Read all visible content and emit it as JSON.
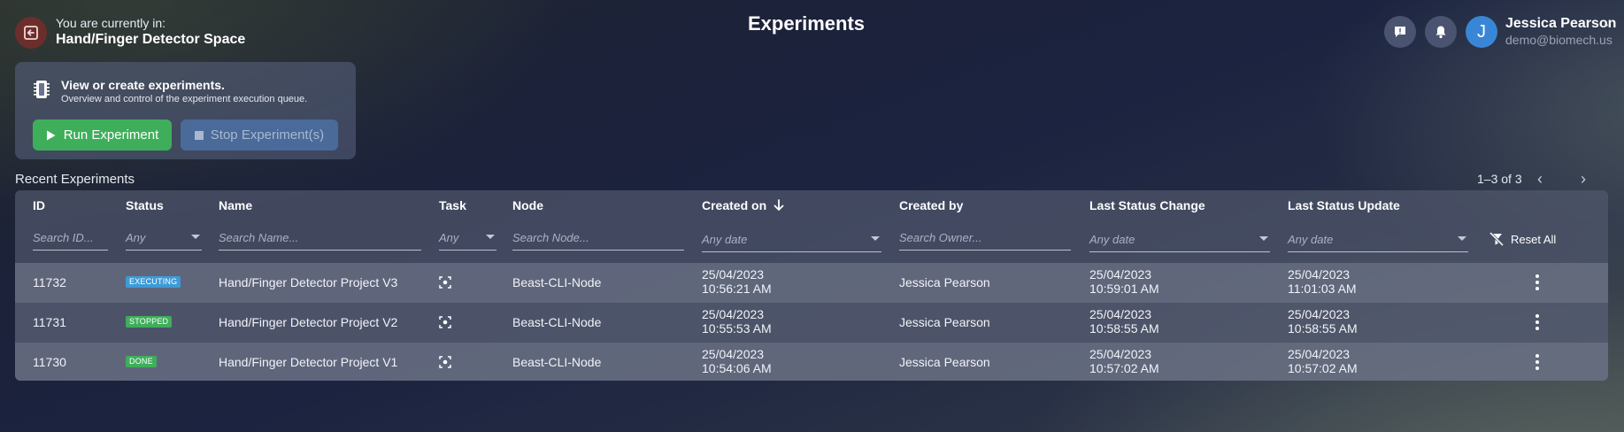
{
  "header": {
    "location_label": "You are currently in:",
    "location_value": "Hand/Finger Detector Space",
    "page_title": "Experiments",
    "user": {
      "initial": "J",
      "name": "Jessica Pearson",
      "email": "demo@biomech.us"
    }
  },
  "card": {
    "title": "View or create experiments.",
    "subtitle": "Overview and control of the experiment execution queue.",
    "run_label": "Run Experiment",
    "stop_label": "Stop Experiment(s)"
  },
  "recent": {
    "title": "Recent Experiments",
    "pagination": "1–3 of 3"
  },
  "table": {
    "headers": {
      "id": "ID",
      "status": "Status",
      "name": "Name",
      "task": "Task",
      "node": "Node",
      "created_on": "Created on",
      "created_by": "Created by",
      "last_status_change": "Last Status Change",
      "last_status_update": "Last Status Update"
    },
    "filters": {
      "id": "Search ID...",
      "status": "Any",
      "name": "Search Name...",
      "task": "Any",
      "node": "Search Node...",
      "created_on": "Any date",
      "created_by": "Search Owner...",
      "last_status_change": "Any date",
      "last_status_update": "Any date",
      "reset": "Reset All"
    },
    "rows": [
      {
        "id": "11732",
        "status": "EXECUTING",
        "status_color": "#3d9bd8",
        "name": "Hand/Finger Detector Project V3",
        "node": "Beast-CLI-Node",
        "created_date": "25/04/2023",
        "created_time": "10:56:21 AM",
        "created_by": "Jessica Pearson",
        "change_date": "25/04/2023",
        "change_time": "10:59:01 AM",
        "update_date": "25/04/2023",
        "update_time": "11:01:03 AM"
      },
      {
        "id": "11731",
        "status": "STOPPED",
        "status_color": "#3fae5b",
        "name": "Hand/Finger Detector Project V2",
        "node": "Beast-CLI-Node",
        "created_date": "25/04/2023",
        "created_time": "10:55:53 AM",
        "created_by": "Jessica Pearson",
        "change_date": "25/04/2023",
        "change_time": "10:58:55 AM",
        "update_date": "25/04/2023",
        "update_time": "10:58:55 AM"
      },
      {
        "id": "11730",
        "status": "DONE",
        "status_color": "#3fae5b",
        "name": "Hand/Finger Detector Project V1",
        "node": "Beast-CLI-Node",
        "created_date": "25/04/2023",
        "created_time": "10:54:06 AM",
        "created_by": "Jessica Pearson",
        "change_date": "25/04/2023",
        "change_time": "10:57:02 AM",
        "update_date": "25/04/2023",
        "update_time": "10:57:02 AM"
      }
    ]
  }
}
